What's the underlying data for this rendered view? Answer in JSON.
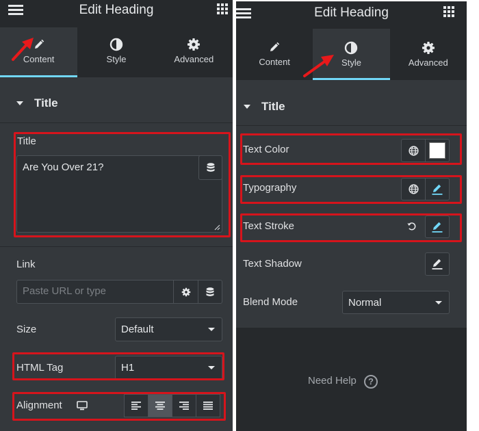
{
  "left": {
    "header_title": "Edit Heading",
    "tabs": [
      {
        "label": "Content",
        "icon": "pencil-icon",
        "active": true
      },
      {
        "label": "Style",
        "icon": "contrast-icon",
        "active": false
      },
      {
        "label": "Advanced",
        "icon": "gear-icon",
        "active": false
      }
    ],
    "section_title": "Title",
    "title_field": {
      "label": "Title",
      "value": "Are You Over 21?"
    },
    "link": {
      "label": "Link",
      "placeholder": "Paste URL or type"
    },
    "size": {
      "label": "Size",
      "value": "Default"
    },
    "html_tag": {
      "label": "HTML Tag",
      "value": "H1"
    },
    "alignment": {
      "label": "Alignment",
      "selected": "center"
    }
  },
  "right": {
    "header_title": "Edit Heading",
    "tabs": [
      {
        "label": "Content",
        "icon": "pencil-icon",
        "active": false
      },
      {
        "label": "Style",
        "icon": "contrast-icon",
        "active": true
      },
      {
        "label": "Advanced",
        "icon": "gear-icon",
        "active": false
      }
    ],
    "section_title": "Title",
    "text_color": {
      "label": "Text Color",
      "swatch": "#ffffff"
    },
    "typography": {
      "label": "Typography"
    },
    "text_stroke": {
      "label": "Text Stroke"
    },
    "text_shadow": {
      "label": "Text Shadow"
    },
    "blend_mode": {
      "label": "Blend Mode",
      "value": "Normal"
    },
    "need_help": "Need Help",
    "help_symbol": "?"
  },
  "colors": {
    "panel_bg": "#34383c",
    "header_bg": "#26292c",
    "accent": "#71d7f7",
    "highlight": "#d6141c",
    "arrow": "#e8191b"
  }
}
